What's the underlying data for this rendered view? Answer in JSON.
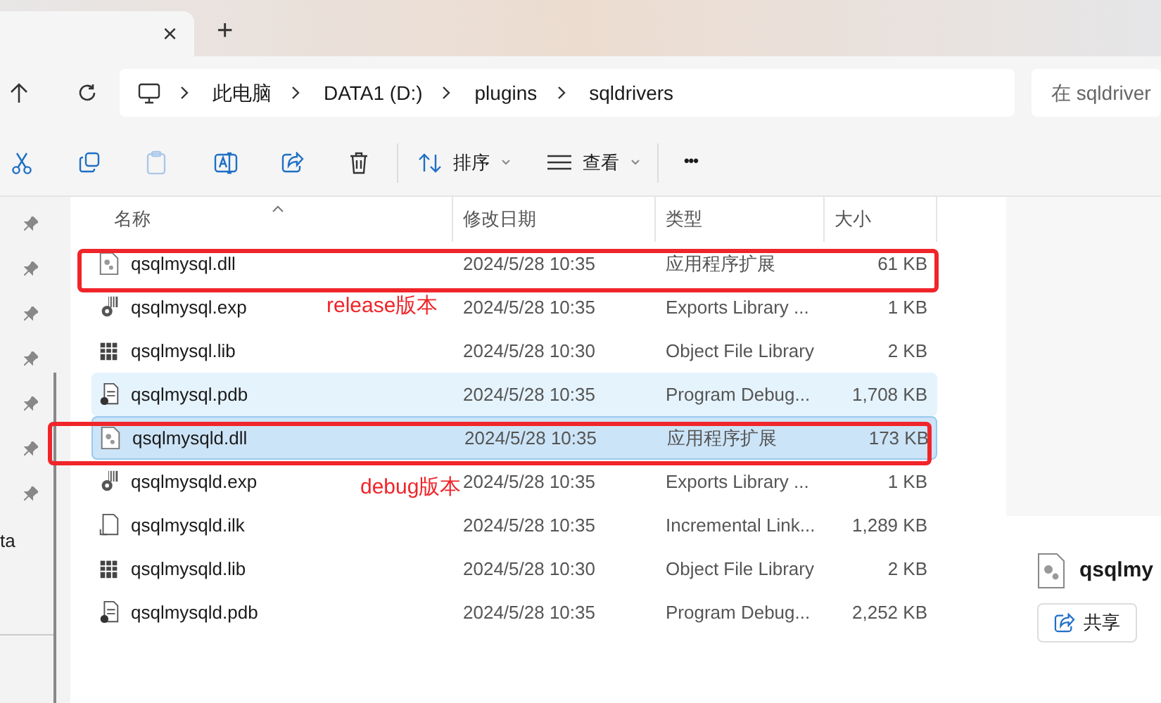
{
  "tab": {
    "close": "×",
    "new": "+"
  },
  "breadcrumb": [
    "此电脑",
    "DATA1 (D:)",
    "plugins",
    "sqldrivers"
  ],
  "search": {
    "placeholder": "在 sqldriver"
  },
  "toolbar": {
    "sort": "排序",
    "view": "查看",
    "more": "•••",
    "paste_disabled": true
  },
  "nav": {
    "items": [
      {
        "pinned": true
      },
      {
        "pinned": true
      },
      {
        "pinned": true
      },
      {
        "pinned": true
      },
      {
        "pinned": true
      },
      {
        "pinned": true
      },
      {
        "pinned": true
      }
    ],
    "partial_label": "ta"
  },
  "columns": [
    "名称",
    "修改日期",
    "类型",
    "大小"
  ],
  "rows": [
    {
      "kind": "dll",
      "name": "qsqlmysql.dll",
      "date": "2024/5/28 10:35",
      "type": "应用程序扩展",
      "size": "61 KB",
      "selected": false,
      "hovered": false,
      "annotation": "release版本"
    },
    {
      "kind": "exp",
      "name": "qsqlmysql.exp",
      "date": "2024/5/28 10:35",
      "type": "Exports Library ...",
      "size": "1 KB",
      "selected": false,
      "hovered": false
    },
    {
      "kind": "lib",
      "name": "qsqlmysql.lib",
      "date": "2024/5/28 10:30",
      "type": "Object File Library",
      "size": "2 KB",
      "selected": false,
      "hovered": false
    },
    {
      "kind": "pdb",
      "name": "qsqlmysql.pdb",
      "date": "2024/5/28 10:35",
      "type": "Program Debug...",
      "size": "1,708 KB",
      "selected": false,
      "hovered": true
    },
    {
      "kind": "dll",
      "name": "qsqlmysqld.dll",
      "date": "2024/5/28 10:35",
      "type": "应用程序扩展",
      "size": "173 KB",
      "selected": true,
      "hovered": false,
      "annotation": "debug版本"
    },
    {
      "kind": "exp",
      "name": "qsqlmysqld.exp",
      "date": "2024/5/28 10:35",
      "type": "Exports Library ...",
      "size": "1 KB",
      "selected": false,
      "hovered": false
    },
    {
      "kind": "ilk",
      "name": "qsqlmysqld.ilk",
      "date": "2024/5/28 10:35",
      "type": "Incremental Link...",
      "size": "1,289 KB",
      "selected": false,
      "hovered": false
    },
    {
      "kind": "lib",
      "name": "qsqlmysqld.lib",
      "date": "2024/5/28 10:30",
      "type": "Object File Library",
      "size": "2 KB",
      "selected": false,
      "hovered": false
    },
    {
      "kind": "pdb",
      "name": "qsqlmysqld.pdb",
      "date": "2024/5/28 10:35",
      "type": "Program Debug...",
      "size": "2,252 KB",
      "selected": false,
      "hovered": false
    }
  ],
  "details": {
    "name": "qsqlmy",
    "share": "共享"
  }
}
